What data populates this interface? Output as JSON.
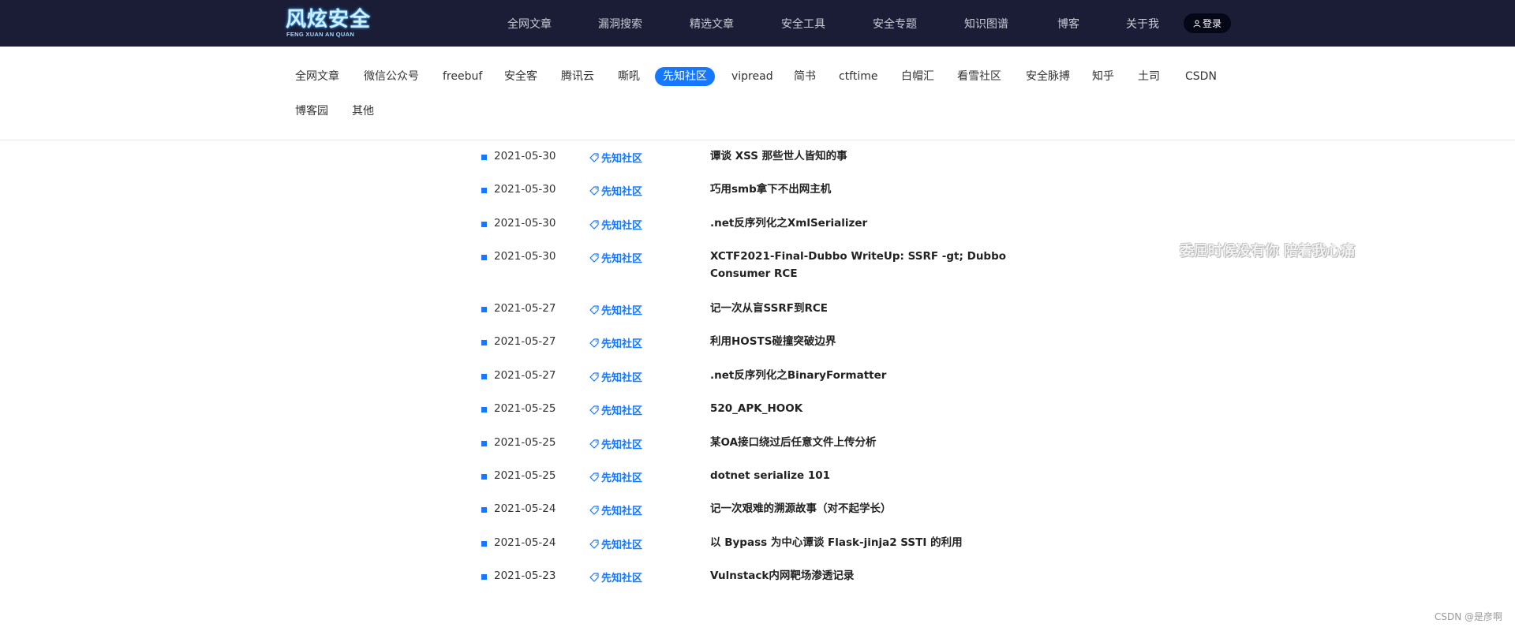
{
  "logo": {
    "text": "风炫安全",
    "subtext": "FENG XUAN AN QUAN"
  },
  "nav": {
    "items": [
      "全网文章",
      "漏洞搜索",
      "精选文章",
      "安全工具",
      "安全专题",
      "知识图谱",
      "博客",
      "关于我"
    ],
    "login_label": "登录"
  },
  "filters": {
    "items": [
      "全网文章",
      "微信公众号",
      "freebuf",
      "安全客",
      "腾讯云",
      "嘶吼",
      "先知社区",
      "vipread",
      "简书",
      "ctftime",
      "白帽汇",
      "看雪社区",
      "安全脉搏",
      "知乎",
      "土司",
      "CSDN",
      "博客园",
      "其他"
    ],
    "active": "先知社区"
  },
  "articles": [
    {
      "date": "2021-05-30",
      "source": "先知社区",
      "title": "谭谈 XSS 那些世人皆知的事"
    },
    {
      "date": "2021-05-30",
      "source": "先知社区",
      "title": "巧用smb拿下不出网主机"
    },
    {
      "date": "2021-05-30",
      "source": "先知社区",
      "title": ".net反序列化之XmlSerializer"
    },
    {
      "date": "2021-05-30",
      "source": "先知社区",
      "title": "XCTF2021-Final-Dubbo WriteUp: SSRF -gt; Dubbo Consumer RCE"
    },
    {
      "date": "2021-05-27",
      "source": "先知社区",
      "title": "记一次从盲SSRF到RCE"
    },
    {
      "date": "2021-05-27",
      "source": "先知社区",
      "title": "利用HOSTS碰撞突破边界"
    },
    {
      "date": "2021-05-27",
      "source": "先知社区",
      "title": ".net反序列化之BinaryFormatter"
    },
    {
      "date": "2021-05-25",
      "source": "先知社区",
      "title": "520_APK_HOOK"
    },
    {
      "date": "2021-05-25",
      "source": "先知社区",
      "title": "某OA接口绕过后任意文件上传分析"
    },
    {
      "date": "2021-05-25",
      "source": "先知社区",
      "title": "dotnet serialize 101"
    },
    {
      "date": "2021-05-24",
      "source": "先知社区",
      "title": "记一次艰难的溯源故事（对不起学长）"
    },
    {
      "date": "2021-05-24",
      "source": "先知社区",
      "title": "以 Bypass 为中心谭谈 Flask-jinja2 SSTI 的利用"
    },
    {
      "date": "2021-05-23",
      "source": "先知社区",
      "title": "Vulnstack内网靶场渗透记录"
    }
  ],
  "side_quote": "委屈时候没有你 陪着我心痛",
  "watermark": "CSDN @是彦啊",
  "colors": {
    "topbar": "#1b1d36",
    "accent": "#1677ff"
  }
}
